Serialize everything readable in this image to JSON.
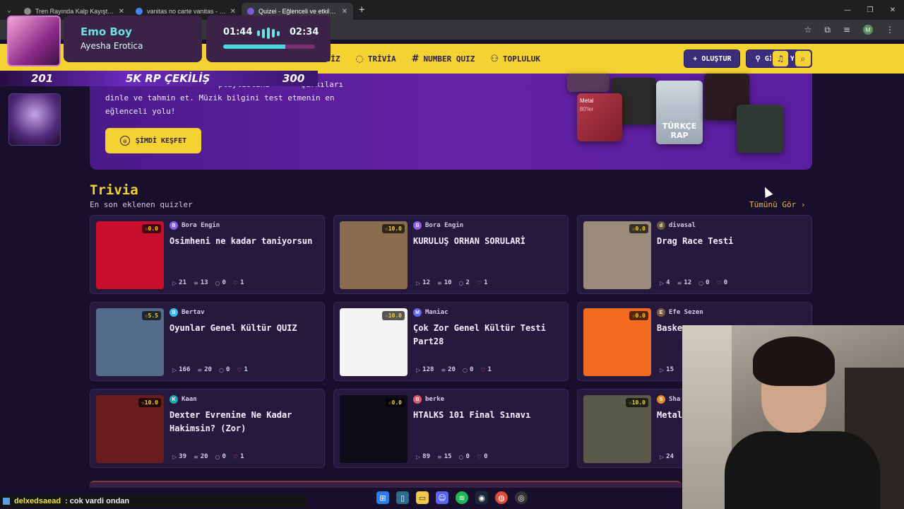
{
  "browser": {
    "tabs": [
      {
        "label": "Tren Rayında Kalp Kayışta - Gü",
        "active": false
      },
      {
        "label": "vanitas no carte vanitas - Goog",
        "active": false
      },
      {
        "label": "Quizei - Eğlenceli ve etkileşimli",
        "active": true
      }
    ],
    "new_tab": "+",
    "window": {
      "minimize": "—",
      "restore": "❐",
      "close": "✕"
    },
    "profile_initial": "M"
  },
  "now_playing": {
    "title": "Emo Boy",
    "artist": "Ayesha Erotica",
    "current_time": "01:44",
    "total_time": "02:34",
    "progress": 0.68
  },
  "stream_stats": {
    "left": "201",
    "middle": "5K RP ÇEKİLİŞ",
    "right": "300"
  },
  "nav": {
    "links": [
      {
        "icon": "",
        "label": "QUİZ"
      },
      {
        "icon": "💬",
        "label": "TRİVİA"
      },
      {
        "icon": "#",
        "label": "NUMBER QUIZ"
      },
      {
        "icon": "👥",
        "label": "TOPLULUK"
      }
    ],
    "create_label": "+ OLUŞTUR",
    "login_label": "GİRİŞ YAP"
  },
  "hero": {
    "line1_end": "playlistini",
    "line1_tail": "şarkıları",
    "line2": "dinle ve tahmin et. Müzik bilgini test etmenin en",
    "line3": "eğlenceli yolu!",
    "cta": "ŞİMDİ KEŞFET",
    "covers": [
      {
        "title": "Metal",
        "subtitle": "80'ler"
      },
      {
        "title": "TÜRKÇE RAP"
      }
    ]
  },
  "trivia": {
    "title": "Trivia",
    "subtitle": "En son eklenen quizler",
    "see_all": "Tümünü Gör ›",
    "cards": [
      {
        "author": "Bora Engin",
        "avatar": "B",
        "avatar_color": "#8b5cf6",
        "rating": "☆0.0",
        "title": "Osimheni ne kadar taniyorsun",
        "plays": "21",
        "questions": "13",
        "comments": "0",
        "likes": "1",
        "thumb": "#c8102e"
      },
      {
        "author": "Bora Engin",
        "avatar": "B",
        "avatar_color": "#8b5cf6",
        "rating": "☆10.0",
        "title": "KURULUŞ ORHAN SORULARİ",
        "plays": "12",
        "questions": "10",
        "comments": "2",
        "likes": "1",
        "thumb": "#8a6d4f"
      },
      {
        "author": "divasal",
        "avatar": "d",
        "avatar_color": "#6b5a3a",
        "rating": "☆0.0",
        "title": "Drag Race Testi",
        "plays": "4",
        "questions": "12",
        "comments": "0",
        "likes": "0",
        "thumb": "#9a8b7a"
      },
      {
        "author": "Bertav",
        "avatar": "B",
        "avatar_color": "#38bdf8",
        "rating": "☆5.5",
        "title": "Oyunlar Genel Kültür QUIZ",
        "plays": "166",
        "questions": "20",
        "comments": "0",
        "likes": "1",
        "thumb": "#556b8a"
      },
      {
        "author": "Maniac",
        "avatar": "M",
        "avatar_color": "#6366f1",
        "rating": "☆10.0",
        "title": "Çok Zor Genel Kültür Testi Part28",
        "plays": "128",
        "questions": "20",
        "comments": "0",
        "likes": "1",
        "thumb": "#f4f4f4"
      },
      {
        "author": "Efe Sezen",
        "avatar": "E",
        "avatar_color": "#7c5a3a",
        "rating": "☆0.0",
        "title": "Baske",
        "plays": "15",
        "questions": "",
        "comments": "",
        "likes": "",
        "thumb": "#f26b21"
      },
      {
        "author": "Kaan",
        "avatar": "K",
        "avatar_color": "#22a6b3",
        "rating": "☆10.0",
        "title": "Dexter Evrenine Ne Kadar Hakimsin? (Zor)",
        "plays": "39",
        "questions": "20",
        "comments": "0",
        "likes": "1",
        "thumb": "#6b1d1d"
      },
      {
        "author": "berke",
        "avatar": "B",
        "avatar_color": "#e05a6a",
        "rating": "☆0.0",
        "title": "HTALKS 101 Final Sınavı",
        "plays": "89",
        "questions": "15",
        "comments": "0",
        "likes": "0",
        "thumb": "#0d0d1a"
      },
      {
        "author": "Sha",
        "avatar": "S",
        "avatar_color": "#e08a2a",
        "rating": "☆10.0",
        "title": "Metal",
        "plays": "24",
        "questions": "",
        "comments": "",
        "likes": "",
        "thumb": "#5a5a4a"
      }
    ]
  },
  "chat": {
    "user": "delxedsaead",
    "message": ": cok vardi ondan"
  }
}
